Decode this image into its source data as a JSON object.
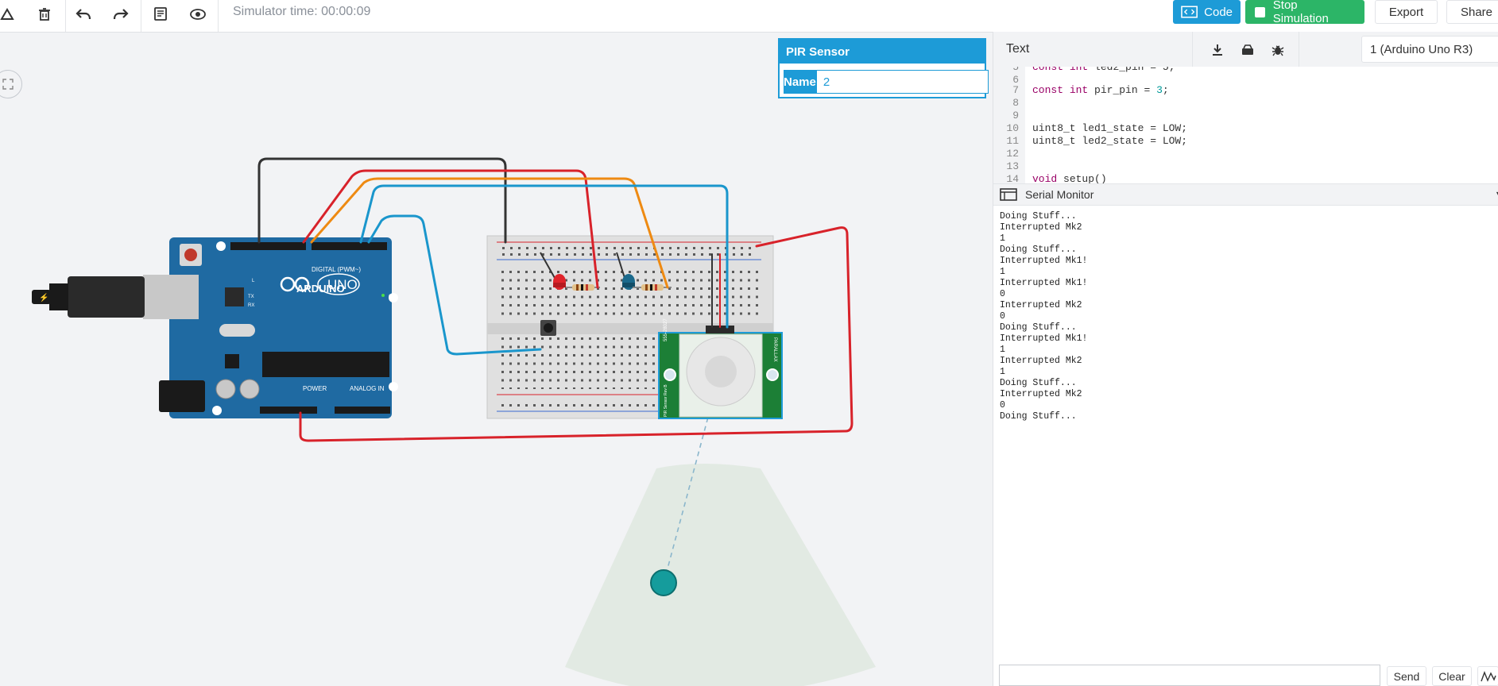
{
  "toolbar": {
    "sim_time": "Simulator time: 00:00:09",
    "code_label": "Code",
    "stop_label": "Stop Simulation",
    "export_label": "Export",
    "share_label": "Share"
  },
  "props_panel": {
    "title": "PIR Sensor",
    "name_label": "Name",
    "name_value": "2"
  },
  "code_panel": {
    "mode_label": "Text",
    "board_select": "1 (Arduino Uno R3)",
    "lines": [
      {
        "n": "6",
        "text": ""
      },
      {
        "n": "7",
        "text": "const int pir_pin = 3;"
      },
      {
        "n": "8",
        "text": ""
      },
      {
        "n": "9",
        "text": ""
      },
      {
        "n": "10",
        "text": "uint8_t led1_state = LOW;"
      },
      {
        "n": "11",
        "text": "uint8_t led2_state = LOW;"
      },
      {
        "n": "12",
        "text": ""
      },
      {
        "n": "13",
        "text": ""
      },
      {
        "n": "14",
        "text": "void setup()"
      }
    ]
  },
  "serial": {
    "title": "Serial Monitor",
    "lines": [
      "Doing Stuff...",
      "Interrupted Mk2",
      "1",
      "Doing Stuff...",
      "Interrupted Mk1!",
      "1",
      "Interrupted Mk1!",
      "0",
      "Interrupted Mk2",
      "0",
      "Doing Stuff...",
      "Interrupted Mk1!",
      "1",
      "Interrupted Mk2",
      "1",
      "Doing Stuff...",
      "Interrupted Mk2",
      "0",
      "Doing Stuff..."
    ],
    "send_label": "Send",
    "clear_label": "Clear"
  },
  "arduino": {
    "brand": "ARDUINO",
    "model": "UNO",
    "digital_label": "DIGITAL (PWM~)",
    "power_label": "POWER",
    "analog_label": "ANALOG IN",
    "on_label": "ON",
    "l_label": "L",
    "tx_label": "TX",
    "rx_label": "RX"
  },
  "pir": {
    "left_label": "555-28027",
    "right_label": "PARALLAX",
    "bottom_label": "PIR Sensor Rev B"
  },
  "colors": {
    "accent_blue": "#1d9bd7",
    "accent_green": "#2cb567",
    "arduino_blue": "#1f6aa2",
    "wire_red": "#d8222a",
    "wire_orange": "#ee8a12",
    "wire_blue": "#1a96cc",
    "wire_black": "#333333"
  }
}
